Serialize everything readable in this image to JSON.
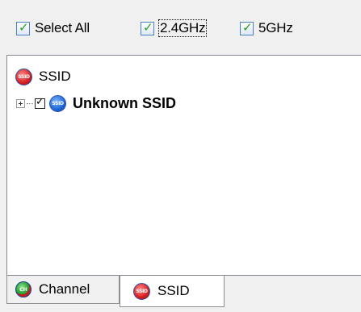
{
  "filters": {
    "select_all_label": "Select All",
    "band_24_label": "2.4GHz",
    "band_5_label": "5GHz"
  },
  "tree": {
    "root_label": "SSID",
    "root_icon_text": "SSID",
    "children": [
      {
        "label": "Unknown SSID",
        "icon_text": "SSID"
      }
    ]
  },
  "tabs": [
    {
      "label": "Channel",
      "icon_text": "CH"
    },
    {
      "label": "SSID",
      "icon_text": "SSID"
    }
  ]
}
